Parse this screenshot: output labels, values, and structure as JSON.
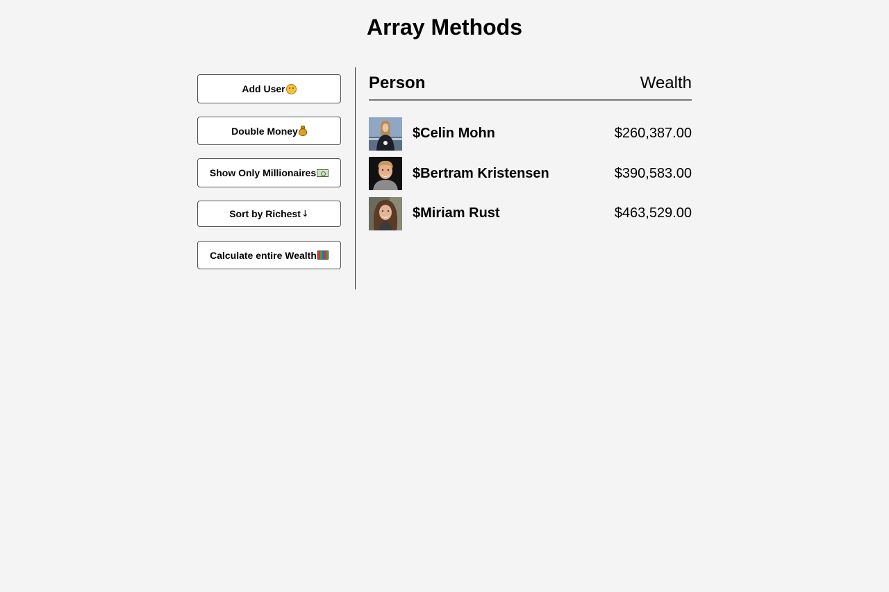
{
  "page": {
    "title": "Array Methods"
  },
  "actions": [
    {
      "label": "Add User",
      "icon": "face-icon"
    },
    {
      "label": "Double Money",
      "icon": "money-bag-icon"
    },
    {
      "label": "Show Only Millionaires",
      "icon": "cash-icon"
    },
    {
      "label": "Sort by Richest",
      "icon": "down-arrow-icon",
      "icon_glyph": "↓"
    },
    {
      "label": "Calculate entire Wealth",
      "icon": "abacus-icon"
    }
  ],
  "table": {
    "header_person": "Person",
    "header_wealth": "Wealth",
    "rows": [
      {
        "name": "$Celin Mohn",
        "wealth": "$260,387.00"
      },
      {
        "name": "$Bertram Kristensen",
        "wealth": "$390,583.00"
      },
      {
        "name": "$Miriam Rust",
        "wealth": "$463,529.00"
      }
    ]
  }
}
